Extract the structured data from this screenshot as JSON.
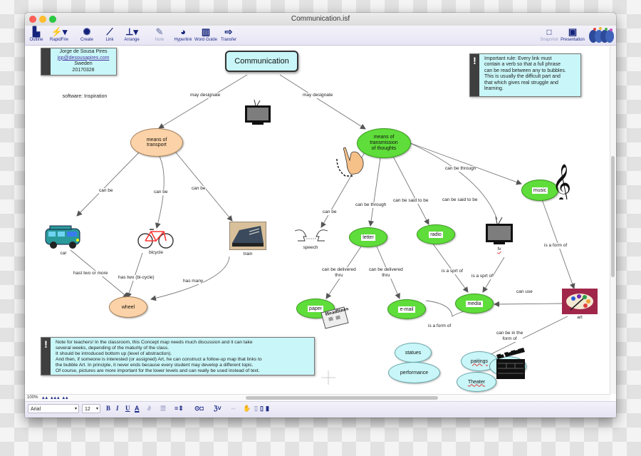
{
  "window": {
    "title": "Communication.isf"
  },
  "toolbar": {
    "left": [
      {
        "label": "Outline",
        "icon": "outline-icon",
        "glyph": "▙",
        "disabled": false
      },
      {
        "label": "RapidFire",
        "icon": "rapidfire-icon",
        "glyph": "⚡▾",
        "disabled": false
      },
      {
        "label": "Create",
        "icon": "create-icon",
        "glyph": "✺",
        "disabled": false
      },
      {
        "label": "Link",
        "icon": "link-icon",
        "glyph": "⟋",
        "disabled": false
      },
      {
        "label": "Arrange",
        "icon": "arrange-icon",
        "glyph": "⊥▾",
        "disabled": false
      },
      {
        "label": "Note",
        "icon": "note-icon",
        "glyph": "✎",
        "disabled": true
      },
      {
        "label": "Hyperlink",
        "icon": "hyperlink-icon",
        "glyph": "◕",
        "disabled": false
      },
      {
        "label": "Word Guide",
        "icon": "word-guide-icon",
        "glyph": "▥",
        "disabled": false
      },
      {
        "label": "Transfer",
        "icon": "transfer-icon",
        "glyph": "⇨",
        "disabled": false
      }
    ],
    "right": [
      {
        "label": "Snapshot",
        "icon": "camera-icon",
        "glyph": "◘",
        "disabled": true
      },
      {
        "label": "Presentation",
        "icon": "presentation-icon",
        "glyph": "▣",
        "disabled": false
      }
    ]
  },
  "author_box": {
    "name": "Jorge de Sousa Pires",
    "email": "jsp@desousapires.com",
    "country": "Sweden",
    "date": "20170328"
  },
  "software_note": "software: Inspiration",
  "important_note": "Important rule: Every link must\ncontain a verb so that a full phrase\ncan be read between any to bubbles.\nThis is usually the difficult part and\nthat which gives real struggle and\nlearning.",
  "teacher_note": "Note for teachers! In the classroom, this Concept map needs much discussion and it can take\nseveral weeks, depending of the maturity of the class.\nIt should be introduced bottom up (level of abstraction).\nAnd then, if someone is interested (or assigned) Art, he can construct a follow-up map that links to\nthe bubble Art. In principle, it never ends because every student may develop a different topic.\nOf course, pictures are more important for the lower levels and can really be used instead of text.",
  "note_marker": "!",
  "map": {
    "root": "Communication",
    "nodes": {
      "transport": "means of\ntransport",
      "thoughts": "means of\ntransmission\nof thoughts",
      "wheel": "wheel",
      "letter": "letter",
      "radio": "radio",
      "music": "music",
      "paper": "paper",
      "email": "e-mail",
      "media": "media",
      "statues": "statues",
      "paitings": "paitings",
      "performance": "performance",
      "cinema": "cinema",
      "theater": "Theater"
    },
    "pictures": {
      "car": "car",
      "bicycle": "bicycle",
      "train": "train",
      "speech": "speech",
      "tv": "tv",
      "art": "art"
    },
    "links": {
      "root_transport": "may designate",
      "root_thoughts": "may designate",
      "transport_car": "can be",
      "transport_bicycle": "can be",
      "transport_train": "can be",
      "car_wheel": "hast two or more",
      "bicycle_wheel": "has two (bi-cycle)",
      "train_wheel": "has many",
      "thoughts_speech": "can be",
      "thoughts_letter": "can be through",
      "thoughts_radio": "can be said to be",
      "tv_thoughts": "can be said to be",
      "thoughts_music": "can be through",
      "letter_paper": "can be delivered\nthru",
      "letter_email": "can be delivered\nthru",
      "radio_media": "is a sprt of",
      "tv_media": "is a sprt of",
      "email_media": "is a form of",
      "music_art": "is a form of",
      "art_media": "can use",
      "art_forms": "can be in the\nform of"
    }
  },
  "status": {
    "zoom": "100%"
  },
  "format_bar": {
    "font": "Arial",
    "size": "12",
    "bold": "B",
    "italic": "I",
    "underline": "U",
    "text_color": "A"
  }
}
